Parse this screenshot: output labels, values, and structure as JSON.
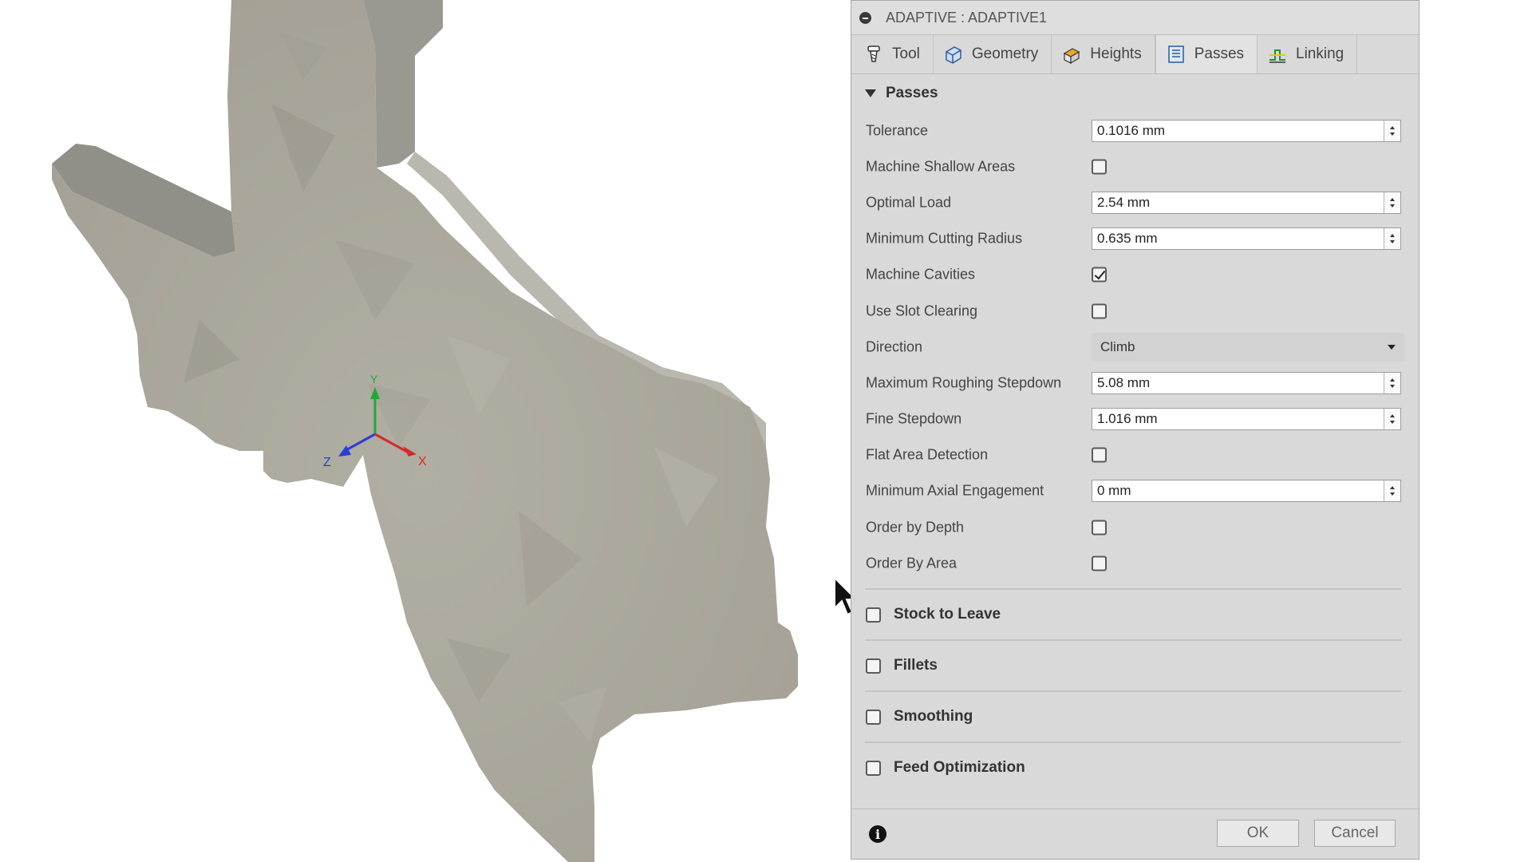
{
  "dialog": {
    "title": "ADAPTIVE : ADAPTIVE1"
  },
  "tabs": [
    {
      "label": "Tool",
      "icon": "tool-icon"
    },
    {
      "label": "Geometry",
      "icon": "geometry-icon"
    },
    {
      "label": "Heights",
      "icon": "heights-icon"
    },
    {
      "label": "Passes",
      "icon": "passes-icon",
      "active": true
    },
    {
      "label": "Linking",
      "icon": "linking-icon"
    }
  ],
  "passes": {
    "section_label": "Passes",
    "tolerance": {
      "label": "Tolerance",
      "value": "0.1016 mm"
    },
    "machine_shallow_areas": {
      "label": "Machine Shallow Areas",
      "checked": false
    },
    "optimal_load": {
      "label": "Optimal Load",
      "value": "2.54 mm"
    },
    "minimum_cutting_radius": {
      "label": "Minimum Cutting Radius",
      "value": "0.635 mm"
    },
    "machine_cavities": {
      "label": "Machine Cavities",
      "checked": true
    },
    "use_slot_clearing": {
      "label": "Use Slot Clearing",
      "checked": false
    },
    "direction": {
      "label": "Direction",
      "value": "Climb"
    },
    "max_roughing_stepdown": {
      "label": "Maximum Roughing Stepdown",
      "value": "5.08 mm"
    },
    "fine_stepdown": {
      "label": "Fine Stepdown",
      "value": "1.016 mm"
    },
    "flat_area_detection": {
      "label": "Flat Area Detection",
      "checked": false
    },
    "min_axial_engagement": {
      "label": "Minimum Axial Engagement",
      "value": "0 mm"
    },
    "order_by_depth": {
      "label": "Order by Depth",
      "checked": false
    },
    "order_by_area": {
      "label": "Order By Area",
      "checked": false
    }
  },
  "groups": {
    "stock_to_leave": "Stock to Leave",
    "fillets": "Fillets",
    "smoothing": "Smoothing",
    "feed_optimization": "Feed Optimization"
  },
  "footer": {
    "ok_label": "OK",
    "cancel_label": "Cancel"
  },
  "viewport": {
    "axis_labels": {
      "x": "X",
      "y": "Y",
      "z": "Z"
    },
    "colors": {
      "model": "#a8a59a",
      "x_axis": "#d42a2a",
      "y_axis": "#1fa83a",
      "z_axis": "#2a3fd4"
    }
  }
}
